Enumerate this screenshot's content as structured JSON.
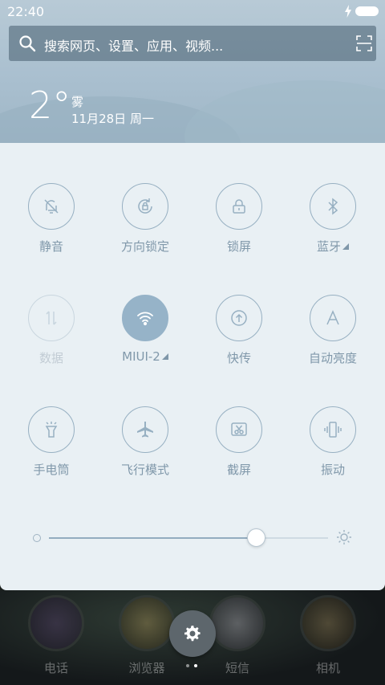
{
  "status_bar": {
    "time": "22:40",
    "icons": [
      "charging-bolt-icon",
      "battery-icon"
    ]
  },
  "search": {
    "placeholder": "搜索网页、设置、应用、视频..."
  },
  "weather": {
    "temperature": "2°",
    "condition": "雾",
    "date": "11月28日 周一"
  },
  "toggles": [
    {
      "label": "静音",
      "icon": "bell-off-icon",
      "state": "off"
    },
    {
      "label": "方向锁定",
      "icon": "rotation-lock-icon",
      "state": "off"
    },
    {
      "label": "锁屏",
      "icon": "lock-icon",
      "state": "off"
    },
    {
      "label": "蓝牙",
      "icon": "bluetooth-icon",
      "state": "off",
      "has_menu": true
    },
    {
      "label": "数据",
      "icon": "mobile-data-icon",
      "state": "disabled"
    },
    {
      "label": "MIUI-2",
      "icon": "wifi-icon",
      "state": "on",
      "has_menu": true
    },
    {
      "label": "快传",
      "icon": "quick-transfer-icon",
      "state": "off"
    },
    {
      "label": "自动亮度",
      "icon": "auto-brightness-icon",
      "state": "off"
    },
    {
      "label": "手电筒",
      "icon": "flashlight-icon",
      "state": "off"
    },
    {
      "label": "飞行模式",
      "icon": "airplane-icon",
      "state": "off"
    },
    {
      "label": "截屏",
      "icon": "screenshot-icon",
      "state": "off"
    },
    {
      "label": "振动",
      "icon": "vibrate-icon",
      "state": "off"
    }
  ],
  "brightness": {
    "level": 0.74
  },
  "dock": {
    "apps": [
      {
        "label": "电话"
      },
      {
        "label": "浏览器"
      },
      {
        "label": "短信"
      },
      {
        "label": "相机"
      }
    ]
  },
  "colors": {
    "accent": "#96b3c8",
    "panel_bg": "#e9f0f4",
    "label": "#8098aa"
  }
}
